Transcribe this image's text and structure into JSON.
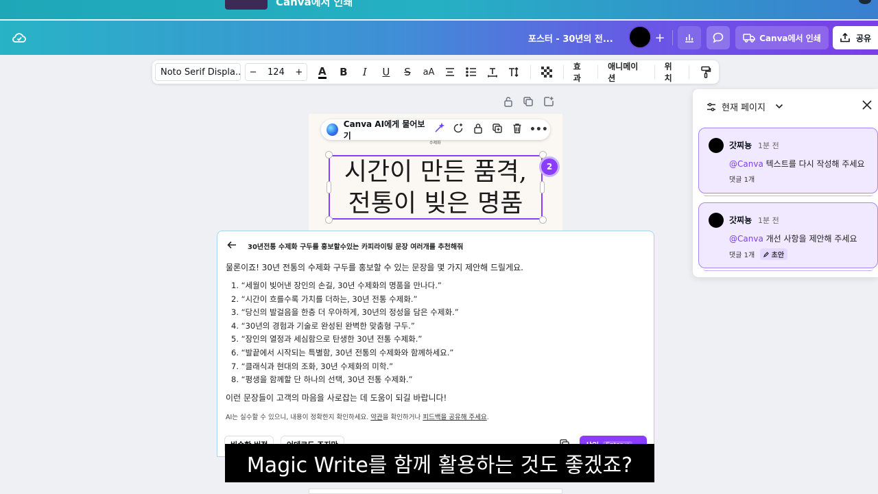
{
  "top_strip": {
    "title": "Canva에서 인쇄"
  },
  "header": {
    "doc_title": "포스터 - 30년의 전...",
    "print_label": "Canva에서 인쇄",
    "share_label": "공유",
    "accent_color": "#7a3fe6"
  },
  "toolbar": {
    "font_name": "Noto Serif Displa...",
    "font_size": "124",
    "minus": "−",
    "plus": "+",
    "case_label": "aA",
    "effects_label": "효과",
    "animation_label": "애니메이션",
    "position_label": "위치"
  },
  "canvas": {
    "ai_pill_label": "Canva AI에게 물어보기",
    "tiny_label": "수제화",
    "headline_line1": "시간이 만든 품격,",
    "headline_line2": "전통이 빚은 명품",
    "comment_badge": "2"
  },
  "comments_panel": {
    "header_label": "현재 페이지",
    "comments": [
      {
        "author": "갓찌뇽",
        "time": "1분 전",
        "mention": "@Canva",
        "text": " 텍스트를 다시 작성해 주세요",
        "replies": "댓글 1개",
        "tag": ""
      },
      {
        "author": "갓찌뇽",
        "time": "1분 전",
        "mention": "@Canva",
        "text": " 개선 사항을 제안해 주세요",
        "replies": "댓글 1개",
        "tag": "초안"
      }
    ]
  },
  "ai_panel": {
    "question": "30년전통 수제화 구두를 홍보할수있는 카피라이팅 문장 여러개를 추천해줘",
    "intro": "물론이죠! 30년 전통의 수제화 구두를 홍보할 수 있는 문장을 몇 가지 제안해 드릴게요.",
    "suggestions": [
      "1. “세월이 빚어낸 장인의 손길, 30년 수제화의 명품을 만나다.”",
      "2. “시간이 흐를수록 가치를 더하는, 30년 전통 수제화.”",
      "3. “당신의 발걸음을 한층 더 우아하게, 30년의 정성을 담은 수제화.”",
      "4. “30년의 경험과 기술로 완성된 완벽한 맞춤형 구두.”",
      "5. “장인의 열정과 세심함으로 탄생한 30년 전통 수제화.”",
      "6. “발끝에서 시작되는 특별함, 30년 전통의 수제화와 함께하세요.”",
      "7. “클래식과 현대의 조화, 30년 수제화의 미학.”",
      "8. “평생을 함께할 단 하나의 선택, 30년 전통 수제화.”"
    ],
    "outro": "이런 문장들이 고객의 마음을 사로잡는 데 도움이 되길 바랍니다!",
    "disclaimer_prefix": "AI는 실수할 수 있으니, 내용이 정확한지 확인하세요. ",
    "disclaimer_terms": "약관",
    "disclaimer_middle": "을 확인하거나 ",
    "disclaimer_feedback": "피드백을 공유해 주세요",
    "disclaimer_suffix": ".",
    "footer_btn1": "비슷한 버전",
    "footer_btn2": "어데코드 조지만",
    "insert_label": "삽입",
    "insert_kbd": "Enter ↵"
  },
  "subtitle": "Magic Write를 함께 활용하는 것도 좋겠죠?"
}
